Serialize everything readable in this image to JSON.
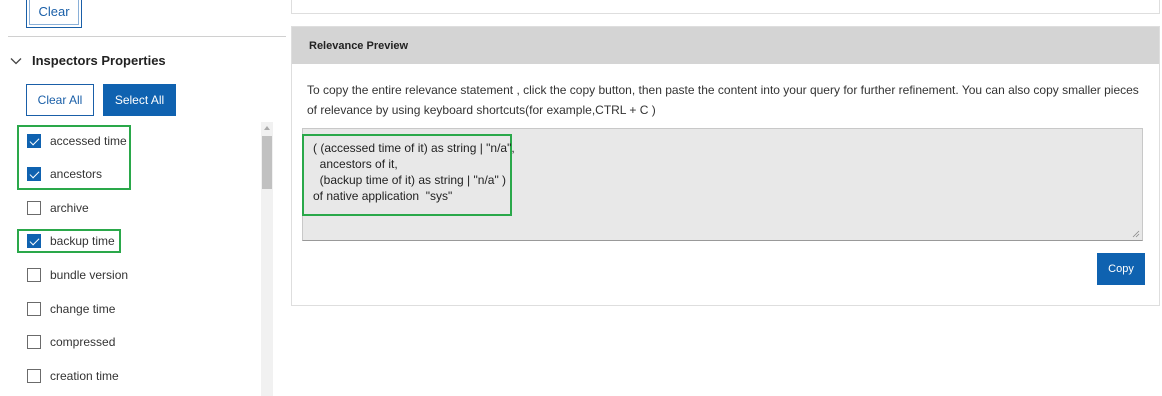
{
  "filters": {
    "clear_label": "Clear"
  },
  "inspectors": {
    "title": "Inspectors Properties",
    "clear_all_label": "Clear All",
    "select_all_label": "Select All",
    "items": [
      {
        "label": "accessed time",
        "checked": true
      },
      {
        "label": "ancestors",
        "checked": true
      },
      {
        "label": "archive",
        "checked": false
      },
      {
        "label": "backup time",
        "checked": true
      },
      {
        "label": "bundle version",
        "checked": false
      },
      {
        "label": "change time",
        "checked": false
      },
      {
        "label": "compressed",
        "checked": false
      },
      {
        "label": "creation time",
        "checked": false
      }
    ]
  },
  "relevance_preview": {
    "title": "Relevance Preview",
    "description": "To copy the entire relevance statement , click the copy button, then paste the content into your query for further refinement. You can also copy smaller pieces of relevance by using keyboard shortcuts(for example,CTRL + C )",
    "lines": [
      "( (accessed time of it) as string | \"n/a\",",
      "  ancestors of it,",
      "  (backup time of it) as string | \"n/a\" )",
      "of native application  \"sys\""
    ],
    "copy_label": "Copy"
  },
  "colors": {
    "accent": "#0f62b0",
    "highlight": "#2aa84a",
    "header_bg": "#d4d4d4",
    "textarea_bg": "#e8e8e8"
  }
}
